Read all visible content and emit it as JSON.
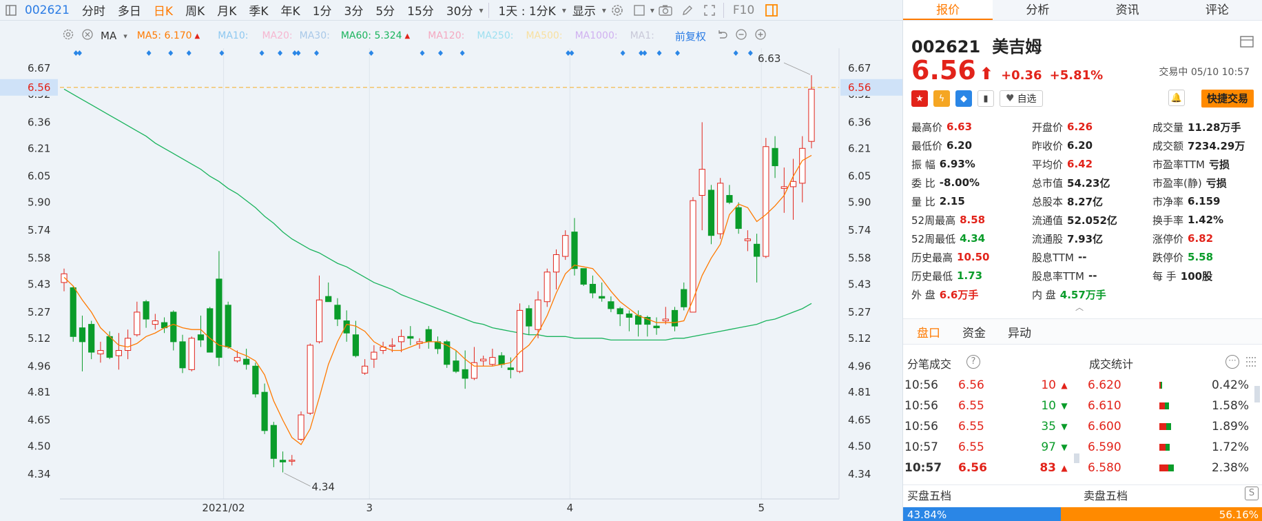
{
  "period_bar": {
    "code": "002621",
    "items": [
      "分时",
      "多日",
      "日K",
      "周K",
      "月K",
      "季K",
      "年K",
      "1分",
      "3分",
      "5分",
      "15分",
      "30分"
    ],
    "active": "日K",
    "more_label": "1天 : 1分K",
    "display_label": "显示",
    "f10": "F10"
  },
  "indicator_bar": {
    "ma_label": "MA",
    "ma5": "MA5: 6.170",
    "ma10": "MA10:",
    "ma20": "MA20:",
    "ma30": "MA30:",
    "ma60": "MA60: 5.324",
    "ma120": "MA120:",
    "ma250": "MA250:",
    "ma500": "MA500:",
    "ma1000": "MA1000:",
    "ma_extra": "MA1:",
    "adjust": "前复权",
    "colors": {
      "ma5": "#ff7a00",
      "ma60": "#19b35c",
      "ma10": "#8ec8f0",
      "ma20": "#f6b6d0",
      "ma30": "#a8c8e8",
      "ma120": "#f4a8c0",
      "ma250": "#9ee0f0",
      "ma500": "#f8e0a0",
      "ma1000": "#d0b0f0"
    }
  },
  "chart_data": {
    "type": "candlestick",
    "y_ticks": [
      "6.67",
      "6.52",
      "6.36",
      "6.21",
      "6.05",
      "5.90",
      "5.74",
      "5.58",
      "5.43",
      "5.27",
      "5.12",
      "4.96",
      "4.81",
      "4.65",
      "4.50",
      "4.34"
    ],
    "ylim": [
      4.34,
      6.67
    ],
    "current_price": "6.56",
    "x_labels": [
      "2021/02",
      "3",
      "4",
      "5"
    ],
    "high_label": "6.63",
    "low_label": "4.34",
    "candles": [
      [
        5.44,
        5.49,
        5.52,
        5.39
      ],
      [
        5.41,
        5.13,
        5.42,
        5.1
      ],
      [
        5.18,
        5.1,
        5.25,
        4.93
      ],
      [
        5.2,
        5.04,
        5.22,
        5.0
      ],
      [
        5.03,
        5.05,
        5.1,
        4.98
      ],
      [
        5.13,
        5.01,
        5.16,
        5.0
      ],
      [
        5.02,
        5.05,
        5.15,
        4.94
      ],
      [
        5.05,
        5.12,
        5.17,
        5.0
      ],
      [
        5.14,
        5.27,
        5.33,
        5.13
      ],
      [
        5.33,
        5.23,
        5.34,
        5.18
      ],
      [
        5.2,
        5.22,
        5.26,
        5.17
      ],
      [
        5.21,
        5.18,
        5.24,
        5.15
      ],
      [
        5.27,
        5.1,
        5.28,
        5.05
      ],
      [
        5.1,
        4.95,
        5.14,
        4.92
      ],
      [
        4.94,
        5.12,
        5.13,
        4.93
      ],
      [
        5.14,
        5.11,
        5.25,
        5.07
      ],
      [
        5.29,
        5.04,
        5.3,
        5.04
      ],
      [
        5.46,
        5.01,
        5.62,
        4.96
      ],
      [
        5.31,
        5.07,
        5.33,
        5.06
      ],
      [
        4.99,
        5.01,
        5.05,
        4.98
      ],
      [
        5.0,
        4.97,
        5.06,
        4.94
      ],
      [
        4.96,
        4.8,
        4.98,
        4.78
      ],
      [
        4.81,
        4.59,
        4.86,
        4.57
      ],
      [
        4.62,
        4.43,
        4.64,
        4.38
      ],
      [
        4.42,
        4.41,
        4.47,
        4.35
      ],
      [
        4.42,
        4.42,
        4.45,
        4.39
      ],
      [
        4.54,
        4.68,
        4.7,
        4.53
      ],
      [
        4.69,
        5.08,
        5.09,
        4.68
      ],
      [
        5.1,
        5.34,
        5.48,
        5.09
      ],
      [
        5.36,
        5.33,
        5.44,
        5.33
      ],
      [
        5.31,
        5.23,
        5.35,
        5.19
      ],
      [
        5.22,
        5.15,
        5.28,
        5.1
      ],
      [
        5.14,
        5.02,
        5.22,
        5.01
      ],
      [
        4.92,
        4.96,
        5.0,
        4.91
      ],
      [
        5.0,
        5.04,
        5.08,
        4.95
      ],
      [
        5.05,
        5.07,
        5.1,
        5.03
      ],
      [
        5.08,
        5.08,
        5.12,
        5.04
      ],
      [
        5.1,
        5.13,
        5.17,
        5.04
      ],
      [
        5.13,
        5.12,
        5.19,
        5.08
      ],
      [
        5.09,
        5.1,
        5.12,
        5.06
      ],
      [
        5.17,
        5.1,
        5.19,
        5.06
      ],
      [
        5.1,
        5.06,
        5.13,
        5.03
      ],
      [
        5.1,
        4.97,
        5.11,
        4.95
      ],
      [
        4.99,
        4.93,
        5.05,
        4.92
      ],
      [
        4.94,
        4.89,
        5.05,
        4.83
      ],
      [
        4.89,
        4.98,
        5.07,
        4.88
      ],
      [
        4.99,
        5.0,
        5.02,
        4.96
      ],
      [
        4.97,
        5.01,
        5.06,
        4.96
      ],
      [
        5.02,
        4.97,
        5.04,
        4.95
      ],
      [
        4.95,
        4.94,
        5.01,
        4.89
      ],
      [
        4.93,
        5.28,
        5.32,
        4.92
      ],
      [
        5.29,
        5.19,
        5.31,
        5.14
      ],
      [
        5.17,
        5.34,
        5.39,
        5.12
      ],
      [
        5.33,
        5.5,
        5.52,
        5.3
      ],
      [
        5.5,
        5.6,
        5.63,
        5.4
      ],
      [
        5.59,
        5.71,
        5.74,
        5.57
      ],
      [
        5.73,
        5.52,
        5.81,
        5.48
      ],
      [
        5.52,
        5.43,
        5.52,
        5.42
      ],
      [
        5.43,
        5.38,
        5.48,
        5.35
      ],
      [
        5.36,
        5.35,
        5.44,
        5.33
      ],
      [
        5.33,
        5.29,
        5.36,
        5.27
      ],
      [
        5.29,
        5.26,
        5.3,
        5.19
      ],
      [
        5.26,
        5.24,
        5.28,
        5.16
      ],
      [
        5.25,
        5.2,
        5.28,
        5.13
      ],
      [
        5.24,
        5.2,
        5.25,
        5.13
      ],
      [
        5.19,
        5.18,
        5.24,
        5.14
      ],
      [
        5.22,
        5.23,
        5.3,
        5.2
      ],
      [
        5.28,
        5.19,
        5.3,
        5.16
      ],
      [
        5.4,
        5.3,
        5.44,
        5.28
      ],
      [
        5.27,
        5.91,
        5.93,
        5.27
      ],
      [
        5.94,
        6.09,
        6.36,
        5.74
      ],
      [
        5.97,
        5.71,
        6.0,
        5.66
      ],
      [
        5.72,
        6.01,
        6.04,
        5.69
      ],
      [
        5.94,
        5.9,
        6.0,
        5.89
      ],
      [
        5.87,
        5.75,
        5.9,
        5.72
      ],
      [
        5.68,
        5.69,
        5.74,
        5.62
      ],
      [
        5.66,
        5.59,
        5.72,
        5.44
      ],
      [
        5.59,
        6.22,
        6.27,
        5.58
      ],
      [
        6.21,
        6.11,
        6.28,
        6.04
      ],
      [
        5.98,
        5.99,
        6.1,
        5.84
      ],
      [
        5.99,
        6.02,
        6.15,
        5.8
      ],
      [
        6.01,
        6.21,
        6.28,
        5.9
      ],
      [
        6.25,
        6.55,
        6.63,
        6.21
      ]
    ],
    "ma5": [
      5.47,
      5.42,
      5.34,
      5.27,
      5.18,
      5.13,
      5.08,
      5.07,
      5.09,
      5.13,
      5.15,
      5.18,
      5.2,
      5.18,
      5.17,
      5.17,
      5.12,
      5.08,
      5.07,
      5.04,
      5.02,
      4.99,
      4.91,
      4.76,
      4.65,
      4.55,
      4.51,
      4.6,
      4.78,
      4.97,
      5.1,
      5.2,
      5.19,
      5.16,
      5.1,
      5.07,
      5.05,
      5.05,
      5.07,
      5.09,
      5.1,
      5.1,
      5.08,
      5.05,
      5.0,
      4.96,
      4.96,
      4.96,
      4.97,
      4.98,
      5.04,
      5.08,
      5.15,
      5.25,
      5.38,
      5.49,
      5.54,
      5.53,
      5.52,
      5.46,
      5.39,
      5.33,
      5.29,
      5.25,
      5.23,
      5.21,
      5.21,
      5.21,
      5.22,
      5.34,
      5.48,
      5.58,
      5.66,
      5.83,
      5.89,
      5.87,
      5.79,
      5.83,
      5.88,
      5.94,
      6.05,
      6.14,
      6.17
    ],
    "ma60": [
      6.55,
      6.52,
      6.49,
      6.46,
      6.43,
      6.4,
      6.37,
      6.34,
      6.31,
      6.28,
      6.24,
      6.21,
      6.18,
      6.15,
      6.12,
      6.09,
      6.05,
      6.02,
      5.98,
      5.95,
      5.91,
      5.87,
      5.82,
      5.78,
      5.73,
      5.69,
      5.66,
      5.63,
      5.61,
      5.58,
      5.55,
      5.53,
      5.5,
      5.47,
      5.44,
      5.42,
      5.4,
      5.37,
      5.35,
      5.33,
      5.31,
      5.29,
      5.27,
      5.25,
      5.23,
      5.21,
      5.2,
      5.18,
      5.17,
      5.16,
      5.15,
      5.14,
      5.14,
      5.13,
      5.13,
      5.13,
      5.12,
      5.12,
      5.12,
      5.12,
      5.11,
      5.11,
      5.11,
      5.11,
      5.11,
      5.11,
      5.11,
      5.12,
      5.12,
      5.13,
      5.14,
      5.15,
      5.16,
      5.17,
      5.18,
      5.19,
      5.2,
      5.22,
      5.23,
      5.25,
      5.27,
      5.29,
      5.32
    ],
    "signal_marks_top": [
      1,
      2,
      9,
      12,
      14,
      17,
      22,
      24,
      25,
      26,
      28,
      34,
      39,
      41,
      44,
      55,
      56,
      61,
      63,
      64,
      65,
      67,
      74,
      75
    ]
  },
  "quote_panel": {
    "tabs": [
      "报价",
      "分析",
      "资讯",
      "评论"
    ],
    "active_tab": "报价",
    "code": "002621",
    "name": "美吉姆",
    "price": "6.56",
    "arrow": "⬆",
    "change": "+0.36",
    "change_pct": "+5.81%",
    "status": "交易中 05/10 10:57",
    "watch_label": "自选",
    "fast_trade": "快捷交易",
    "stats": [
      {
        "label": "最高价",
        "value": "6.63",
        "tone": "up"
      },
      {
        "label": "开盘价",
        "value": "6.26",
        "tone": "up"
      },
      {
        "label": "成交量",
        "value": "11.28万手",
        "tone": ""
      },
      {
        "label": "最低价",
        "value": "6.20",
        "tone": ""
      },
      {
        "label": "昨收价",
        "value": "6.20",
        "tone": ""
      },
      {
        "label": "成交额",
        "value": "7234.29万",
        "tone": ""
      },
      {
        "label": "振 幅",
        "value": "6.93%",
        "tone": ""
      },
      {
        "label": "平均价",
        "value": "6.42",
        "tone": "up"
      },
      {
        "label": "市盈率TTM",
        "value": "亏损",
        "tone": ""
      },
      {
        "label": "委 比",
        "value": "-8.00%",
        "tone": ""
      },
      {
        "label": "总市值",
        "value": "54.23亿",
        "tone": ""
      },
      {
        "label": "市盈率(静)",
        "value": "亏损",
        "tone": ""
      },
      {
        "label": "量 比",
        "value": "2.15",
        "tone": ""
      },
      {
        "label": "总股本",
        "value": "8.27亿",
        "tone": ""
      },
      {
        "label": "市净率",
        "value": "6.159",
        "tone": ""
      },
      {
        "label": "52周最高",
        "value": "8.58",
        "tone": "up"
      },
      {
        "label": "流通值",
        "value": "52.052亿",
        "tone": ""
      },
      {
        "label": "换手率",
        "value": "1.42%",
        "tone": ""
      },
      {
        "label": "52周最低",
        "value": "4.34",
        "tone": "down"
      },
      {
        "label": "流通股",
        "value": "7.93亿",
        "tone": ""
      },
      {
        "label": "涨停价",
        "value": "6.82",
        "tone": "up"
      },
      {
        "label": "历史最高",
        "value": "10.50",
        "tone": "up"
      },
      {
        "label": "股息TTM",
        "value": "--",
        "tone": ""
      },
      {
        "label": "跌停价",
        "value": "5.58",
        "tone": "down"
      },
      {
        "label": "历史最低",
        "value": "1.73",
        "tone": "down"
      },
      {
        "label": "股息率TTM",
        "value": "--",
        "tone": ""
      },
      {
        "label": "每 手",
        "value": "100股",
        "tone": ""
      },
      {
        "label": "外 盘",
        "value": "6.6万手",
        "tone": "up"
      },
      {
        "label": "内 盘",
        "value": "4.57万手",
        "tone": "down"
      }
    ],
    "sub_tabs": [
      "盘口",
      "资金",
      "异动"
    ],
    "active_sub_tab": "盘口",
    "ticks_title": "分笔成交",
    "volstats_title": "成交统计",
    "ticks": [
      {
        "time": "10:56",
        "price": "6.56",
        "vol": "10",
        "dir": "up"
      },
      {
        "time": "10:56",
        "price": "6.55",
        "vol": "10",
        "dir": "down"
      },
      {
        "time": "10:56",
        "price": "6.55",
        "vol": "35",
        "dir": "down"
      },
      {
        "time": "10:57",
        "price": "6.55",
        "vol": "97",
        "dir": "down"
      },
      {
        "time": "10:57",
        "price": "6.56",
        "vol": "83",
        "dir": "up"
      }
    ],
    "volstats": [
      {
        "price": "6.620",
        "pct": "0.42%",
        "share": 0.042
      },
      {
        "price": "6.610",
        "pct": "1.58%",
        "share": 0.158
      },
      {
        "price": "6.600",
        "pct": "1.89%",
        "share": 0.189
      },
      {
        "price": "6.590",
        "pct": "1.72%",
        "share": 0.172
      },
      {
        "price": "6.580",
        "pct": "2.38%",
        "share": 0.238
      }
    ],
    "book_buy_title": "买盘五档",
    "book_sell_title": "卖盘五档",
    "book_buy_pct": "43.84%",
    "book_sell_pct": "56.16%",
    "book_buy_share": 0.4384
  }
}
